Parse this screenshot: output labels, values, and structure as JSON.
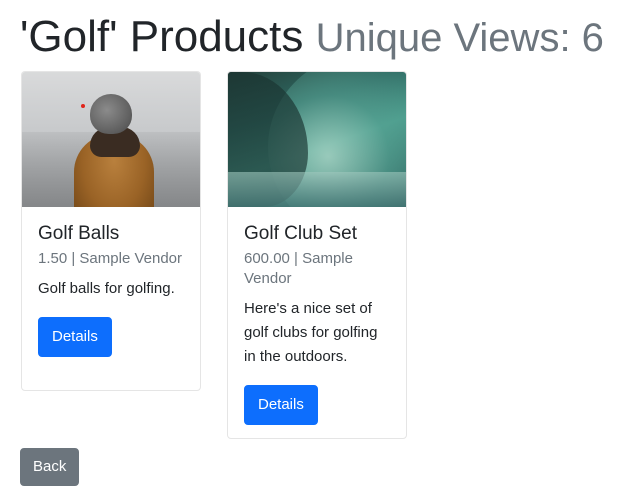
{
  "header": {
    "title": "'Golf' Products",
    "subtitle": "Unique Views: 6"
  },
  "products": [
    {
      "name": "Golf Balls",
      "meta": "1.50 | Sample Vendor",
      "description": "Golf balls for golfing.",
      "details_label": "Details",
      "image_icon": "person-in-hoodie-photo"
    },
    {
      "name": "Golf Club Set",
      "meta": "600.00 | Sample Vendor",
      "description": "Here's a nice set of golf clubs for golfing in the outdoors.",
      "details_label": "Details",
      "image_icon": "ocean-wave-photo"
    }
  ],
  "footer": {
    "back_label": "Back"
  },
  "colors": {
    "primary": "#0d6efd",
    "secondary": "#6c757d",
    "muted_text": "#6c757d"
  }
}
